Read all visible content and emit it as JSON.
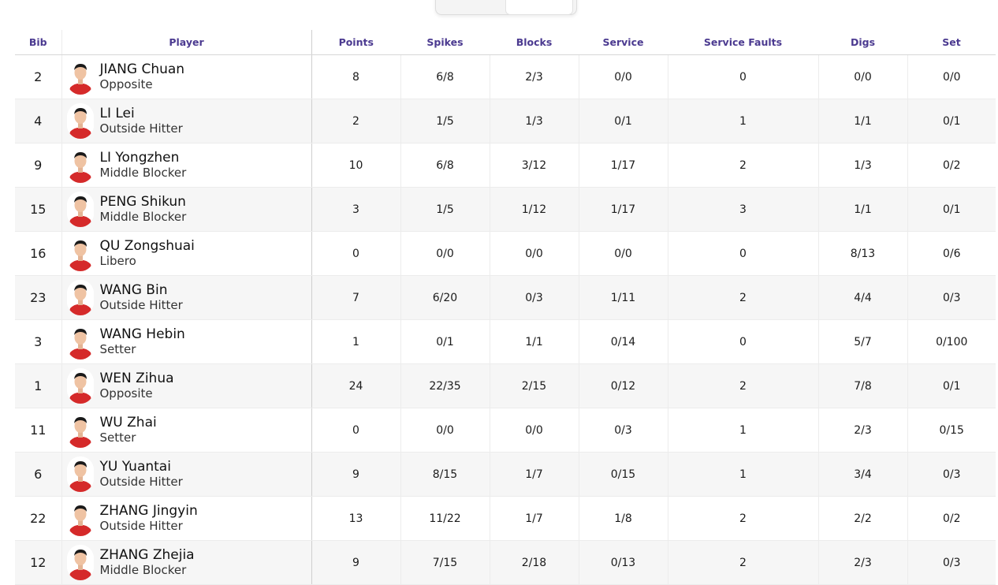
{
  "columns": [
    "Bib",
    "Player",
    "Points",
    "Spikes",
    "Blocks",
    "Service",
    "Service Faults",
    "Digs",
    "Set"
  ],
  "colors": {
    "header_text": "#4b3a90",
    "jersey_red": "#d52a2a"
  },
  "players": [
    {
      "bib": "2",
      "name": "JIANG Chuan",
      "position": "Opposite",
      "points": "8",
      "spikes": "6/8",
      "blocks": "2/3",
      "service": "0/0",
      "service_faults": "0",
      "digs": "0/0",
      "set": "0/0"
    },
    {
      "bib": "4",
      "name": "LI Lei",
      "position": "Outside Hitter",
      "points": "2",
      "spikes": "1/5",
      "blocks": "1/3",
      "service": "0/1",
      "service_faults": "1",
      "digs": "1/1",
      "set": "0/1"
    },
    {
      "bib": "9",
      "name": "LI Yongzhen",
      "position": "Middle Blocker",
      "points": "10",
      "spikes": "6/8",
      "blocks": "3/12",
      "service": "1/17",
      "service_faults": "2",
      "digs": "1/3",
      "set": "0/2"
    },
    {
      "bib": "15",
      "name": "PENG Shikun",
      "position": "Middle Blocker",
      "points": "3",
      "spikes": "1/5",
      "blocks": "1/12",
      "service": "1/17",
      "service_faults": "3",
      "digs": "1/1",
      "set": "0/1"
    },
    {
      "bib": "16",
      "name": "QU Zongshuai",
      "position": "Libero",
      "points": "0",
      "spikes": "0/0",
      "blocks": "0/0",
      "service": "0/0",
      "service_faults": "0",
      "digs": "8/13",
      "set": "0/6"
    },
    {
      "bib": "23",
      "name": "WANG Bin",
      "position": "Outside Hitter",
      "points": "7",
      "spikes": "6/20",
      "blocks": "0/3",
      "service": "1/11",
      "service_faults": "2",
      "digs": "4/4",
      "set": "0/3"
    },
    {
      "bib": "3",
      "name": "WANG Hebin",
      "position": "Setter",
      "points": "1",
      "spikes": "0/1",
      "blocks": "1/1",
      "service": "0/14",
      "service_faults": "0",
      "digs": "5/7",
      "set": "0/100"
    },
    {
      "bib": "1",
      "name": "WEN Zihua",
      "position": "Opposite",
      "points": "24",
      "spikes": "22/35",
      "blocks": "2/15",
      "service": "0/12",
      "service_faults": "2",
      "digs": "7/8",
      "set": "0/1"
    },
    {
      "bib": "11",
      "name": "WU Zhai",
      "position": "Setter",
      "points": "0",
      "spikes": "0/0",
      "blocks": "0/0",
      "service": "0/3",
      "service_faults": "1",
      "digs": "2/3",
      "set": "0/15"
    },
    {
      "bib": "6",
      "name": "YU Yuantai",
      "position": "Outside Hitter",
      "points": "9",
      "spikes": "8/15",
      "blocks": "1/7",
      "service": "0/15",
      "service_faults": "1",
      "digs": "3/4",
      "set": "0/3"
    },
    {
      "bib": "22",
      "name": "ZHANG Jingyin",
      "position": "Outside Hitter",
      "points": "13",
      "spikes": "11/22",
      "blocks": "1/7",
      "service": "1/8",
      "service_faults": "2",
      "digs": "2/2",
      "set": "0/2"
    },
    {
      "bib": "12",
      "name": "ZHANG Zhejia",
      "position": "Middle Blocker",
      "points": "9",
      "spikes": "7/15",
      "blocks": "2/18",
      "service": "0/13",
      "service_faults": "2",
      "digs": "2/3",
      "set": "0/3"
    }
  ]
}
